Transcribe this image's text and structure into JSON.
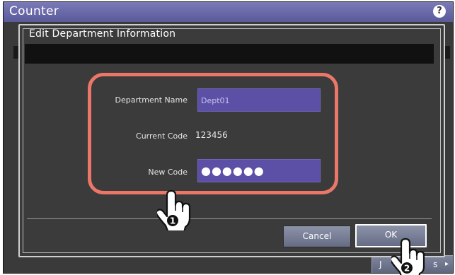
{
  "window": {
    "title": "Counter",
    "help_symbol": "?"
  },
  "background": {
    "button_label": "J",
    "button_label_tail": "s",
    "button_arrow": "▸"
  },
  "dialog": {
    "title": "Edit Department Information",
    "fields": {
      "department_name": {
        "label": "Department Name",
        "value": "Dept01"
      },
      "current_code": {
        "label": "Current Code",
        "value": "123456"
      },
      "new_code": {
        "label": "New Code",
        "value": "●●●●●●"
      }
    },
    "buttons": {
      "cancel": "Cancel",
      "ok": "OK"
    }
  },
  "annotations": {
    "highlight_color": "#ea7767",
    "steps": [
      "1",
      "2"
    ]
  },
  "colors": {
    "field_fill": "#5b4fa6",
    "header_fill": "#6a6aaa",
    "dialog_fill": "#3b3b3b"
  }
}
